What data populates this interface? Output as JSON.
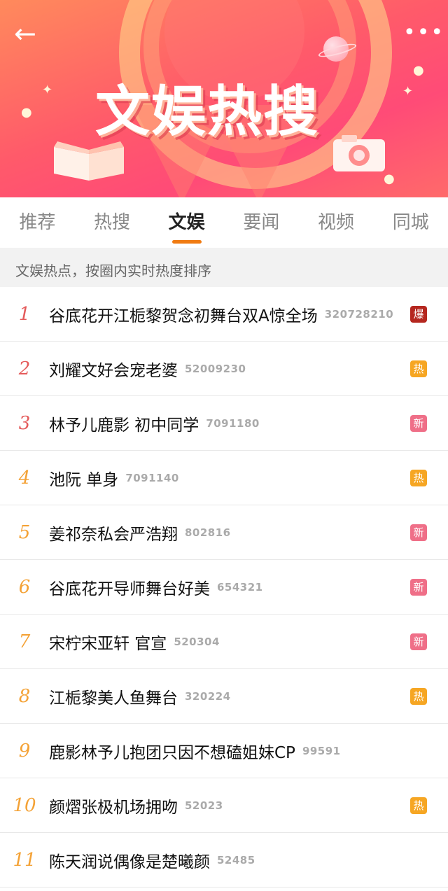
{
  "header": {
    "title": "文娱热搜",
    "back_icon": "←",
    "more_icon": "•••"
  },
  "tabs": [
    {
      "label": "推荐",
      "active": false
    },
    {
      "label": "热搜",
      "active": false
    },
    {
      "label": "文娱",
      "active": true
    },
    {
      "label": "要闻",
      "active": false
    },
    {
      "label": "视频",
      "active": false
    },
    {
      "label": "同城",
      "active": false
    }
  ],
  "subtitle": "文娱热点，按圈内实时热度排序",
  "badge_colors": {
    "爆": "#b5271f",
    "热": "#f6a623",
    "新": "#ef6f88"
  },
  "items": [
    {
      "rank": "1",
      "topic": "谷底花开江栀黎贺念初舞台双A惊全场",
      "count": "320728210",
      "badge": "爆"
    },
    {
      "rank": "2",
      "topic": "刘耀文好会宠老婆",
      "count": "52009230",
      "badge": "热"
    },
    {
      "rank": "3",
      "topic": "林予儿鹿影 初中同学",
      "count": "7091180",
      "badge": "新"
    },
    {
      "rank": "4",
      "topic": "池阮 单身",
      "count": "7091140",
      "badge": "热"
    },
    {
      "rank": "5",
      "topic": "姜祁奈私会严浩翔",
      "count": "802816",
      "badge": "新"
    },
    {
      "rank": "6",
      "topic": "谷底花开导师舞台好美",
      "count": "654321",
      "badge": "新"
    },
    {
      "rank": "7",
      "topic": "宋柠宋亚轩 官宣",
      "count": "520304",
      "badge": "新"
    },
    {
      "rank": "8",
      "topic": "江栀黎美人鱼舞台",
      "count": "320224",
      "badge": "热"
    },
    {
      "rank": "9",
      "topic": "鹿影林予儿抱团只因不想磕姐妹CP",
      "count": "99591",
      "badge": ""
    },
    {
      "rank": "10",
      "topic": "颜熠张极机场拥吻",
      "count": "52023",
      "badge": "热"
    },
    {
      "rank": "11",
      "topic": "陈天润说偶像是楚曦颜",
      "count": "52485",
      "badge": ""
    }
  ]
}
